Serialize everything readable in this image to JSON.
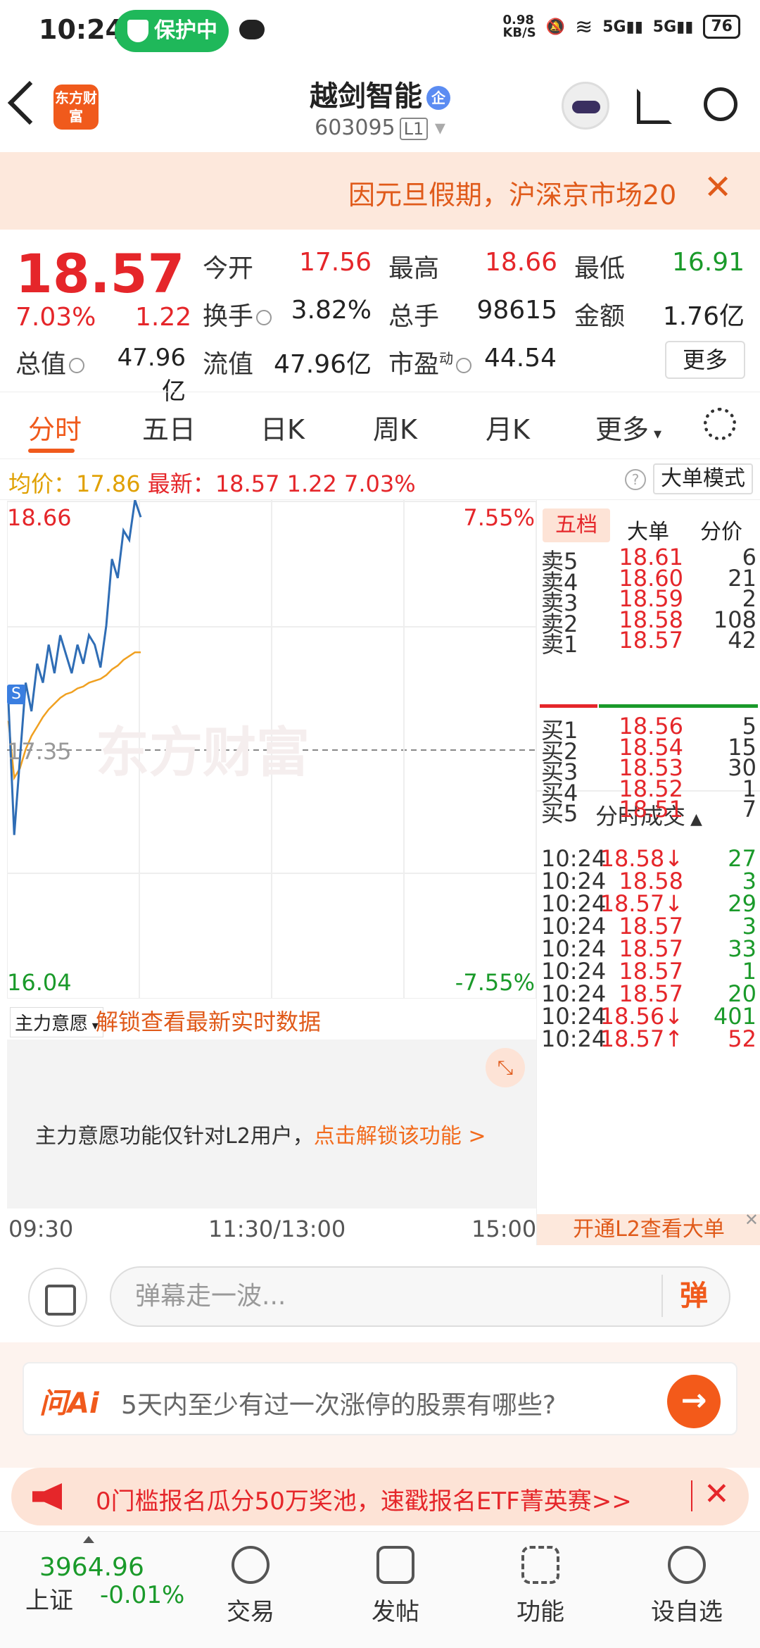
{
  "status_bar": {
    "time": "10:24",
    "protect": "保护中",
    "speed": "0.98\nKB/S",
    "battery": "76"
  },
  "header": {
    "stock_name": "越剑智能",
    "badge": "企",
    "code": "603095",
    "level": "L1",
    "logo_text": "东方财富"
  },
  "notice": {
    "text": "因元旦假期，沪深京市场20",
    "close": "✕"
  },
  "quote": {
    "price": "18.57",
    "pct": "7.03%",
    "change": "1.22",
    "open_label": "今开",
    "open": "17.56",
    "high_label": "最高",
    "high": "18.66",
    "low_label": "最低",
    "low": "16.91",
    "turnover_label": "换手",
    "turnover": "3.82%",
    "volume_label": "总手",
    "volume": "98615",
    "amount_label": "金额",
    "amount": "1.76亿",
    "mcap_label": "总值",
    "mcap": "47.96亿",
    "float_label": "流值",
    "float": "47.96亿",
    "pe_label": "市盈",
    "pe_sup": "动",
    "pe": "44.54",
    "more": "更多"
  },
  "tabs": [
    "分时",
    "五日",
    "日K",
    "周K",
    "月K",
    "更多"
  ],
  "avg_bar": {
    "avg_label": "均价：",
    "avg": "17.86",
    "latest_label": "最新：",
    "latest": "18.57",
    "chg": "1.22",
    "pct": "7.03%",
    "help": "?",
    "mode": "大单模式"
  },
  "chart_labels": {
    "top_price": "18.66",
    "top_pct": "7.55%",
    "mid_price": "17.35",
    "bottom_price": "16.04",
    "bottom_pct": "-7.55%",
    "watermark": "东方财富",
    "marker": "S"
  },
  "chart_data": {
    "type": "line",
    "ylim": [
      16.04,
      18.66
    ],
    "xlim_minutes": [
      0,
      240
    ],
    "series": [
      {
        "values": [
          17.6,
          16.9,
          17.3,
          17.7,
          17.55,
          17.8,
          17.7,
          17.9,
          17.75,
          17.95,
          17.85,
          17.75,
          17.9,
          17.8,
          17.95,
          17.9,
          17.78,
          18.0,
          18.35,
          18.25,
          18.5,
          18.45,
          18.66,
          18.57
        ]
      },
      {
        "values": [
          17.5,
          17.2,
          17.25,
          17.35,
          17.42,
          17.47,
          17.52,
          17.56,
          17.59,
          17.62,
          17.64,
          17.65,
          17.67,
          17.68,
          17.7,
          17.71,
          17.72,
          17.74,
          17.77,
          17.79,
          17.82,
          17.84,
          17.86,
          17.86
        ]
      }
    ]
  },
  "book": {
    "tabs": [
      "五档",
      "大单",
      "分价"
    ],
    "asks": [
      {
        "label": "卖5",
        "price": "18.61",
        "vol": "6"
      },
      {
        "label": "卖4",
        "price": "18.60",
        "vol": "21"
      },
      {
        "label": "卖3",
        "price": "18.59",
        "vol": "2"
      },
      {
        "label": "卖2",
        "price": "18.58",
        "vol": "108"
      },
      {
        "label": "卖1",
        "price": "18.57",
        "vol": "42"
      }
    ],
    "bids": [
      {
        "label": "买1",
        "price": "18.56",
        "vol": "5"
      },
      {
        "label": "买2",
        "price": "18.54",
        "vol": "15"
      },
      {
        "label": "买3",
        "price": "18.53",
        "vol": "30"
      },
      {
        "label": "买4",
        "price": "18.52",
        "vol": "1"
      },
      {
        "label": "买5",
        "price": "18.51",
        "vol": "7"
      }
    ],
    "ticks_header": "分时成交",
    "ticks": [
      {
        "time": "10:24",
        "price": "18.58↓",
        "vol": "27",
        "pc": "red",
        "vc": "green"
      },
      {
        "time": "10:24",
        "price": "18.58",
        "vol": "3",
        "pc": "red",
        "vc": "green"
      },
      {
        "time": "10:24",
        "price": "18.57↓",
        "vol": "29",
        "pc": "red",
        "vc": "green"
      },
      {
        "time": "10:24",
        "price": "18.57",
        "vol": "3",
        "pc": "red",
        "vc": "green"
      },
      {
        "time": "10:24",
        "price": "18.57",
        "vol": "33",
        "pc": "red",
        "vc": "green"
      },
      {
        "time": "10:24",
        "price": "18.57",
        "vol": "1",
        "pc": "red",
        "vc": "green"
      },
      {
        "time": "10:24",
        "price": "18.57",
        "vol": "20",
        "pc": "red",
        "vc": "green"
      },
      {
        "time": "10:24",
        "price": "18.56↓",
        "vol": "401",
        "pc": "red",
        "vc": "green"
      },
      {
        "time": "10:24",
        "price": "18.57↑",
        "vol": "52",
        "pc": "red",
        "vc": "red"
      }
    ],
    "l2_bar": "开通L2查看大单"
  },
  "main_force": {
    "select": "主力意愿",
    "unlock": "解锁查看最新实时数据",
    "msg": "主力意愿功能仅针对L2用户，",
    "msg_link": "点击解锁该功能 >"
  },
  "xaxis": {
    "start": "09:30",
    "mid": "11:30/13:00",
    "end": "15:00"
  },
  "danmu": {
    "placeholder": "弹幕走一波...",
    "btn": "弹"
  },
  "ai": {
    "logo": "问Ai",
    "text": "5天内至少有过一次涨停的股票有哪些?",
    "go": "→"
  },
  "promo": {
    "text": "0门槛报名瓜分50万奖池，速戳报名ETF菁英赛>>",
    "close": "✕"
  },
  "nav": {
    "index_value": "3964.96",
    "index_name": "上证",
    "index_chg": "-0.01%",
    "items": [
      "交易",
      "发帖",
      "功能",
      "设自选"
    ]
  },
  "colors": {
    "up": "#e5262a",
    "down": "#1a9a2a",
    "accent": "#f05a1c",
    "price_line": "#2f6db5",
    "avg_line": "#f0a020"
  }
}
